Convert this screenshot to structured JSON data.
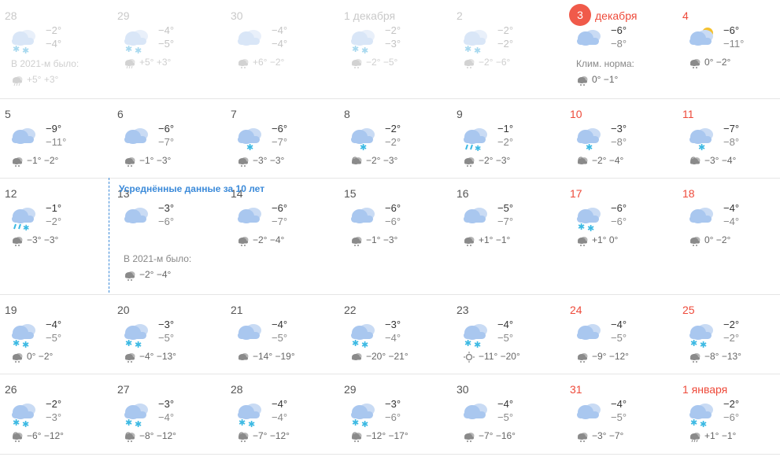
{
  "notice": "Усреднённые данные за 10 лет",
  "past_year_label": "В 2021-м было:",
  "norm_label": "Клим. норма:",
  "rows": [
    [
      {
        "day": "28",
        "hi": "−2°",
        "lo": "−4°",
        "norm": "+5° +3°",
        "past": true,
        "icon": "snow-cloud",
        "normIcon": "rain-cloud",
        "label": "В 2021-м было:"
      },
      {
        "day": "29",
        "hi": "−4°",
        "lo": "−5°",
        "norm": "+5° +3°",
        "past": true,
        "icon": "snow-cloud",
        "normIcon": "rain-cloud"
      },
      {
        "day": "30",
        "hi": "−4°",
        "lo": "−4°",
        "norm": "+6° −2°",
        "past": true,
        "icon": "cloud",
        "normIcon": "snow-cloud-small"
      },
      {
        "day": "1 декабря",
        "hi": "−2°",
        "lo": "−3°",
        "norm": "−2° −5°",
        "past": true,
        "icon": "snow-cloud",
        "normIcon": "snow-cloud-small"
      },
      {
        "day": "2",
        "hi": "−2°",
        "lo": "−2°",
        "norm": "−2° −6°",
        "past": true,
        "icon": "snow-cloud",
        "normIcon": "snow-cloud-small"
      },
      {
        "day": "3",
        "month": "декабря",
        "hi": "−6°",
        "lo": "−8°",
        "norm": "0° −1°",
        "today": true,
        "icon": "cloud",
        "normIcon": "snow-cloud-small",
        "label": "Клим. норма:"
      },
      {
        "day": "4",
        "hi": "−6°",
        "lo": "−11°",
        "norm": "0° −2°",
        "red": true,
        "icon": "sun-cloud",
        "normIcon": "snow-cloud-small"
      }
    ],
    [
      {
        "day": "5",
        "hi": "−9°",
        "lo": "−11°",
        "norm": "−1° −2°",
        "icon": "cloud",
        "normIcon": "snow-cloud-small"
      },
      {
        "day": "6",
        "hi": "−6°",
        "lo": "−7°",
        "norm": "−1° −3°",
        "icon": "cloud",
        "normIcon": "snow-cloud-small"
      },
      {
        "day": "7",
        "hi": "−6°",
        "lo": "−7°",
        "norm": "−3° −3°",
        "icon": "snow1",
        "normIcon": "snow-cloud-small"
      },
      {
        "day": "8",
        "hi": "−2°",
        "lo": "−2°",
        "norm": "−2° −3°",
        "icon": "snow1",
        "normIcon": "sun-cloud-small"
      },
      {
        "day": "9",
        "hi": "−1°",
        "lo": "−2°",
        "norm": "−2° −3°",
        "icon": "sleet",
        "normIcon": "snow-cloud-small"
      },
      {
        "day": "10",
        "hi": "−3°",
        "lo": "−8°",
        "norm": "−2° −4°",
        "red": true,
        "icon": "snow1",
        "normIcon": "sun-cloud-small"
      },
      {
        "day": "11",
        "hi": "−7°",
        "lo": "−8°",
        "norm": "−3° −4°",
        "red": true,
        "icon": "snow1",
        "normIcon": "sun-cloud-small"
      }
    ],
    [
      {
        "day": "12",
        "hi": "−1°",
        "lo": "−2°",
        "norm": "−3° −3°",
        "icon": "sleet",
        "normIcon": "snow-cloud-small"
      },
      {
        "day": "13",
        "hi": "−3°",
        "lo": "−6°",
        "norm": "−2° −4°",
        "icon": "cloud",
        "normIcon": "snow-cloud-small",
        "label": "В 2021-м было:",
        "labelDark": true
      },
      {
        "day": "14",
        "hi": "−6°",
        "lo": "−7°",
        "norm": "−2° −4°",
        "icon": "cloud",
        "normIcon": "snow-cloud-small"
      },
      {
        "day": "15",
        "hi": "−6°",
        "lo": "−6°",
        "norm": "−1° −3°",
        "icon": "cloud",
        "normIcon": "snow-cloud-small"
      },
      {
        "day": "16",
        "hi": "−5°",
        "lo": "−7°",
        "norm": "+1° −1°",
        "icon": "cloud",
        "normIcon": "snow-cloud-small"
      },
      {
        "day": "17",
        "hi": "−6°",
        "lo": "−6°",
        "norm": "+1° 0°",
        "red": true,
        "icon": "snow2",
        "normIcon": "snow-cloud-small"
      },
      {
        "day": "18",
        "hi": "−4°",
        "lo": "−4°",
        "norm": "0° −2°",
        "red": true,
        "icon": "cloud",
        "normIcon": "snow-cloud-small"
      }
    ],
    [
      {
        "day": "19",
        "hi": "−4°",
        "lo": "−5°",
        "norm": "0° −2°",
        "icon": "snow2",
        "normIcon": "snow-cloud-small"
      },
      {
        "day": "20",
        "hi": "−3°",
        "lo": "−5°",
        "norm": "−4° −13°",
        "icon": "snow2",
        "normIcon": "snow-cloud-small"
      },
      {
        "day": "21",
        "hi": "−4°",
        "lo": "−5°",
        "norm": "−14° −19°",
        "icon": "cloud",
        "normIcon": "cloud-small"
      },
      {
        "day": "22",
        "hi": "−3°",
        "lo": "−4°",
        "norm": "−20° −21°",
        "icon": "snow2",
        "normIcon": "cloud-small"
      },
      {
        "day": "23",
        "hi": "−4°",
        "lo": "−5°",
        "norm": "−11° −20°",
        "icon": "snow2",
        "normIcon": "sun-small"
      },
      {
        "day": "24",
        "hi": "−4°",
        "lo": "−5°",
        "norm": "−9° −12°",
        "red": true,
        "icon": "cloud",
        "normIcon": "snow-cloud-small"
      },
      {
        "day": "25",
        "hi": "−2°",
        "lo": "−2°",
        "norm": "−8° −13°",
        "red": true,
        "icon": "snow2",
        "normIcon": "snow-cloud-small"
      }
    ],
    [
      {
        "day": "26",
        "hi": "−2°",
        "lo": "−3°",
        "norm": "−6° −12°",
        "icon": "snow2",
        "normIcon": "sun-snow-small"
      },
      {
        "day": "27",
        "hi": "−3°",
        "lo": "−4°",
        "norm": "−8° −12°",
        "icon": "snow2",
        "normIcon": "sun-snow-small"
      },
      {
        "day": "28",
        "hi": "−4°",
        "lo": "−4°",
        "norm": "−7° −12°",
        "icon": "snow2",
        "normIcon": "sun-snow-small"
      },
      {
        "day": "29",
        "hi": "−3°",
        "lo": "−6°",
        "norm": "−12° −17°",
        "icon": "snow2",
        "normIcon": "sun-snow-small"
      },
      {
        "day": "30",
        "hi": "−4°",
        "lo": "−5°",
        "norm": "−7° −16°",
        "icon": "cloud",
        "normIcon": "snow-cloud-small"
      },
      {
        "day": "31",
        "hi": "−4°",
        "lo": "−5°",
        "norm": "−3° −7°",
        "red": true,
        "icon": "cloud",
        "normIcon": "snow-cloud-small"
      },
      {
        "day": "1 января",
        "hi": "−2°",
        "lo": "−6°",
        "norm": "+1° −1°",
        "red": true,
        "icon": "snow2",
        "normIcon": "rain-cloud"
      }
    ]
  ]
}
